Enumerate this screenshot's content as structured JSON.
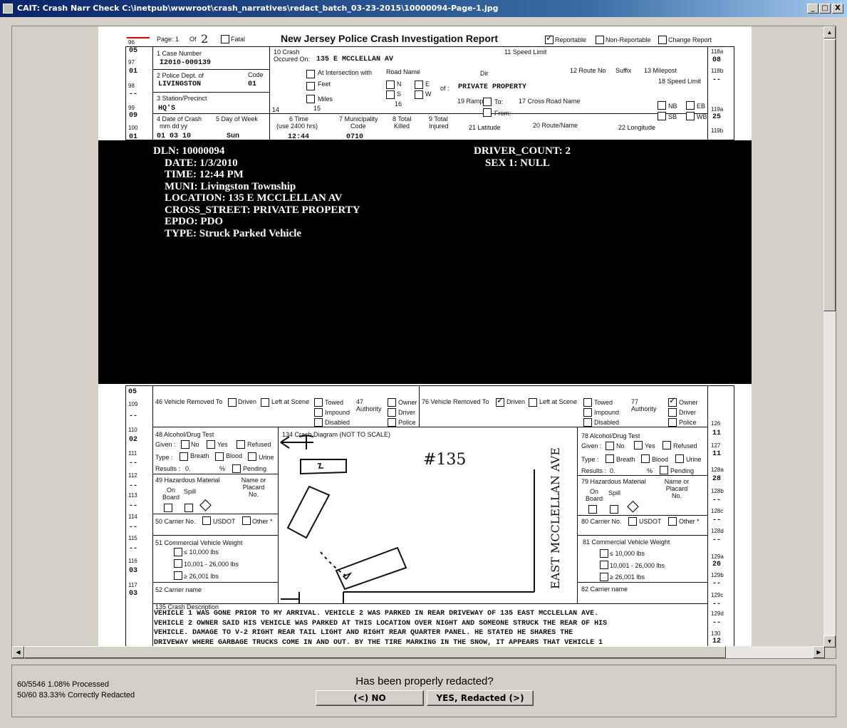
{
  "window": {
    "title": "CAIT: Crash Narr Check C:\\inetpub\\wwwroot\\crash_narratives\\redact_batch_03-23-2015\\10000094-Page-1.jpg",
    "minimize": "_",
    "maximize": "□",
    "close": "X"
  },
  "doc": {
    "header_title": "New Jersey Police Crash Investigation Report",
    "page_label": "Page: 1",
    "of_label": "Of",
    "page_of_value": "2",
    "fatal": "Fatal",
    "reportable": "Reportable",
    "non_reportable": "Non-Reportable",
    "change_report": "Change Report",
    "case_number_label": "1 Case Number",
    "case_number": "I2010-000139",
    "police_dept_label": "2 Police Dept. of",
    "police_dept": "LIVINGSTON",
    "code_label": "Code",
    "code": "01",
    "station_label": "3 Station/Precinct",
    "station": "HQ'S",
    "date_label": "4 Date of Crash",
    "date_fmt": "mm dd yy",
    "date_value": "01 03 10",
    "day_label": "5 Day of Week",
    "day_value": "Sun",
    "time_label": "6 Time",
    "time_fmt": "(use 2400 hrs)",
    "time_value": "12:44",
    "muni_label": "7 Municipality",
    "muni_label2": "Code",
    "muni_value": "0710",
    "total_killed": "8 Total",
    "killed": "Killed",
    "total_injured": "9 Total",
    "injured": "Injured",
    "crash_occ_label": "10 Crash",
    "occured_on": "Occured On:",
    "location": "135 E MCCLELLAN AV",
    "speed_limit": "11 Speed Limit",
    "route_no": "12 Route No",
    "suffix": "Suffix",
    "milepost": "13 Milepost",
    "speed_limit18": "18 Speed Limit",
    "at_intersection": "At Intersection with",
    "road_name": "Road Name",
    "dir": "Dir",
    "feet": "Feet",
    "miles": "Miles",
    "of_label2": "of :",
    "cross_value": "PRIVATE PROPERTY",
    "n": "N",
    "s": "S",
    "e": "E",
    "w": "W",
    "ramp": "19 Ramp",
    "to": "To:",
    "from": "From:",
    "cross_road_label": "17 Cross Road Name",
    "lat": "21 Latitude",
    "route_name": "20 Route/Name",
    "lon": "22 Longitude",
    "nb": "NB",
    "sb": "SB",
    "eb": "EB",
    "wb": "WB",
    "f14": "14",
    "f15": "15",
    "f16": "16",
    "left_codes": [
      {
        "label": "96",
        "value": "05"
      },
      {
        "label": "97",
        "value": "01"
      },
      {
        "label": "98",
        "value": "--"
      },
      {
        "label": "99",
        "value": "09"
      },
      {
        "label": "100",
        "value": "01"
      }
    ],
    "right_codes": [
      {
        "label": "118a",
        "value": "08"
      },
      {
        "label": "118b",
        "value": "--"
      },
      {
        "label": "119a",
        "value": "25"
      },
      {
        "label": "119b",
        "value": ""
      }
    ],
    "veh_removed_46": "46 Vehicle Removed To",
    "veh_removed_76": "76 Vehicle Removed To",
    "driven": "Driven",
    "left_scene": "Left at Scene",
    "towed": "Towed",
    "impound": "Impound",
    "disabled": "Disabled",
    "authority47": "47 Authority",
    "authority77": "77 Authority",
    "owner": "Owner",
    "driver": "Driver",
    "police": "Police",
    "alcohol48": "48 Alcohol/Drug Test",
    "alcohol78": "78 Alcohol/Drug Test",
    "given": "Given :",
    "no": "No",
    "yes": "Yes",
    "refused": "Refused",
    "type": "Type :",
    "breath": "Breath",
    "blood": "Blood",
    "urine": "Urine",
    "results": "Results :",
    "results_val": "0.",
    "pct": "%",
    "pending": "Pending",
    "hazmat49": "49 Hazardous Material",
    "hazmat79": "79 Hazardous Material",
    "on_board": "On Board",
    "spill": "Spill",
    "placard": "Name or Placard No.",
    "carrier50": "50 Carrier No.",
    "carrier80": "80 Carrier No.",
    "usdot": "USDOT",
    "other": "Other *",
    "cvw51": "51 Commercial Vehicle Weight",
    "cvw81": "81 Commercial Vehicle Weight",
    "w1": "≤ 10,000 lbs",
    "w2": "10,001 - 26,000 lbs",
    "w3": "≥ 26,001 lbs",
    "carrier52": "52 Carrier name",
    "carrier82": "82 Carrier name",
    "diagram_label": "134 Crash Diagram (NOT TO SCALE)",
    "hand_num": "#135",
    "street_name": "EAST MCCLELLAN AVE",
    "narr_label": "135 Crash Description",
    "narrative": [
      "VEHICLE 1 WAS GONE PRIOR TO MY ARRIVAL. VEHICLE 2 WAS PARKED IN REAR DRIVEWAY OF 135 EAST MCCLELLAN AVE.",
      "VEHICLE 2 OWNER SAID HIS VEHICLE WAS PARKED AT THIS LOCATION OVER NIGHT AND SOMEONE STRUCK THE REAR OF HIS",
      "VEHICLE.  DAMAGE TO V-2 RIGHT REAR TAIL LIGHT AND RIGHT REAR QUARTER PANEL. HE STATED HE SHARES THE",
      "DRIVEWAY WHERE GARBAGE TRUCKS COME IN AND OUT. BY THE TIRE MARKING IN THE SNOW, IT APPEARS THAT VEHICLE 1"
    ],
    "left_codes2": [
      {
        "label": "108",
        "value": "05"
      },
      {
        "label": "109",
        "value": "--"
      },
      {
        "label": "110",
        "value": "02"
      },
      {
        "label": "111",
        "value": "--"
      },
      {
        "label": "112",
        "value": "--"
      },
      {
        "label": "113",
        "value": "--"
      },
      {
        "label": "114",
        "value": "--"
      },
      {
        "label": "115",
        "value": "--"
      },
      {
        "label": "116",
        "value": "03"
      },
      {
        "label": "117",
        "value": "03"
      }
    ],
    "right_codes2": [
      {
        "label": "126",
        "value": "11"
      },
      {
        "label": "127",
        "value": "11"
      },
      {
        "label": "128a",
        "value": "28"
      },
      {
        "label": "128b",
        "value": "--"
      },
      {
        "label": "128c",
        "value": "--"
      },
      {
        "label": "128d",
        "value": "--"
      },
      {
        "label": "129a",
        "value": "26"
      },
      {
        "label": "129b",
        "value": "--"
      },
      {
        "label": "129c",
        "value": "--"
      },
      {
        "label": "129d",
        "value": "--"
      },
      {
        "label": "130",
        "value": "12"
      }
    ]
  },
  "overlay": {
    "dln": "DLN: 10000094",
    "date": "DATE:  1/3/2010",
    "time": "TIME:  12:44 PM",
    "muni": "MUNI:  Livingston Township",
    "location": "LOCATION:  135 E MCCLELLAN AV",
    "cross_street": "CROSS_STREET:  PRIVATE PROPERTY",
    "epdo": "EPDO:  PDO",
    "type": "TYPE:  Struck Parked Vehicle",
    "driver_count": "DRIVER_COUNT:  2",
    "sex1": "SEX 1:  NULL"
  },
  "footer": {
    "processed": "60/5546 1.08% Processed",
    "correct": "50/60 83.33% Correctly Redacted",
    "question": "Has been properly redacted?",
    "no_button": "(<) NO",
    "yes_button": "YES, Redacted (>)"
  }
}
